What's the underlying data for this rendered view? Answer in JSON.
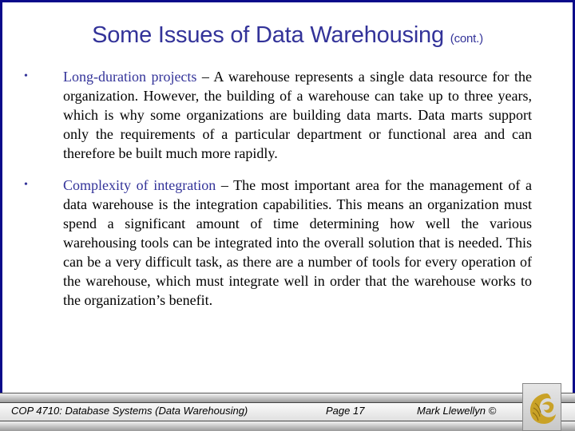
{
  "slide": {
    "title": "Some Issues of Data Warehousing",
    "title_suffix": "(cont.)",
    "bullets": [
      {
        "marker": "•",
        "term": "Long-duration projects",
        "text": " – A warehouse represents a single data resource for the organization.  However, the building of a warehouse can take up to three years, which is why some organizations are building data marts.  Data marts support only the requirements of a particular department or functional area and can therefore be built much more rapidly."
      },
      {
        "marker": "•",
        "term": "Complexity of integration",
        "text": " – The most important area for the management of a data warehouse is the integration capabilities.  This means an organization must spend a significant amount of time determining how well the various warehousing tools can be integrated into the overall solution that is needed.  This can be a very difficult task, as there are a number of tools for every operation of the warehouse, which must integrate well in order that the warehouse works to the organization’s benefit."
      }
    ]
  },
  "footer": {
    "course": "COP 4710: Database Systems  (Data Warehousing)",
    "page": "Page 17",
    "author": "Mark Llewellyn ©",
    "logo_icon": "pegasus-logo-icon"
  },
  "colors": {
    "border": "#0a0a8a",
    "title": "#333399",
    "term": "#333399",
    "logo_gold": "#c9a227"
  }
}
